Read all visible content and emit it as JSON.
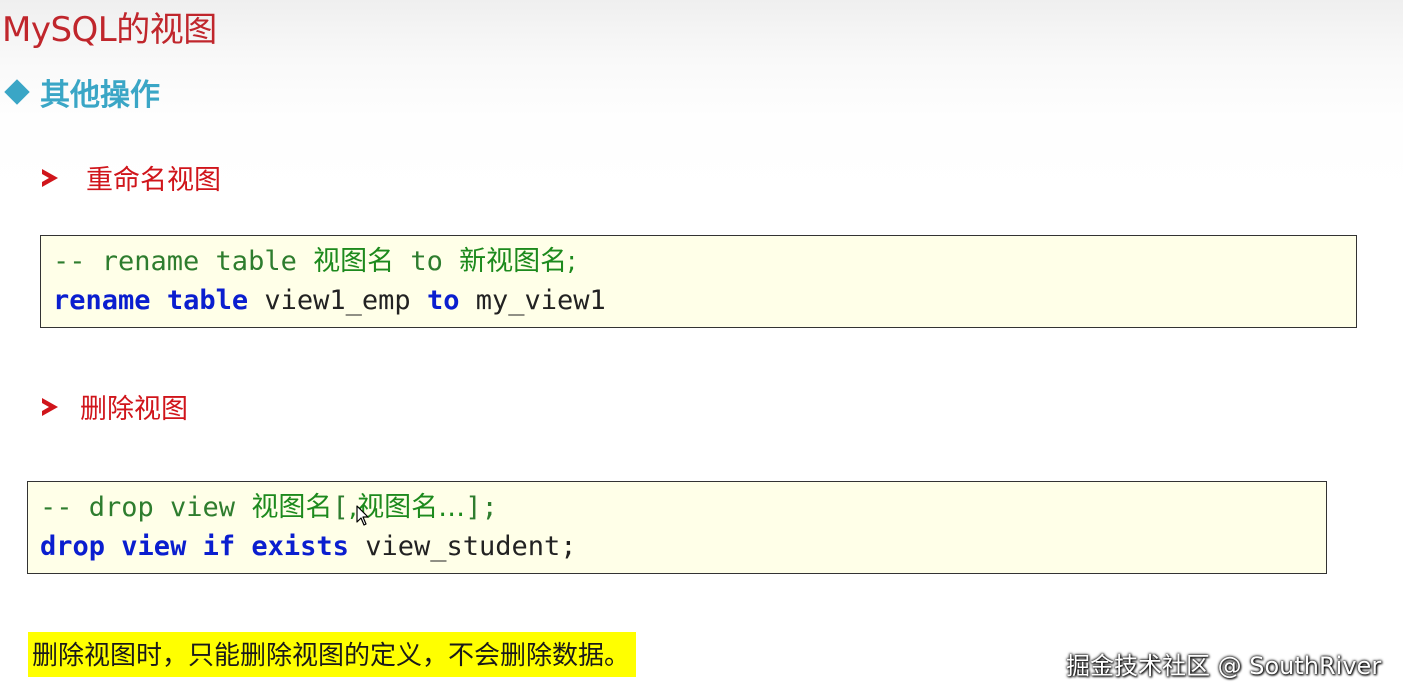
{
  "slide": {
    "title": "MySQL的视图",
    "section_heading": "其他操作"
  },
  "rename": {
    "heading": "重命名视图",
    "comment_prefix": "-- rename table ",
    "comment_name": "视图名",
    "comment_to": " to ",
    "comment_new_name": "新视图名;",
    "kw_rename": "rename",
    "kw_table": "table",
    "view_old": "view1_emp",
    "kw_to": "to",
    "view_new": "my_view1"
  },
  "drop": {
    "heading": "删除视图",
    "comment_prefix": "-- drop view ",
    "comment_name": "视图名",
    "comment_bracket_open": "[",
    "comment_more": ",视图名…",
    "comment_bracket_close": "];",
    "kw_drop": "drop",
    "kw_view": "view",
    "kw_if": "if",
    "kw_exists": "exists",
    "view_name": "view_student;"
  },
  "note": "删除视图时，只能删除视图的定义，不会删除数据。",
  "watermark": "掘金技术社区 @ SouthRiver",
  "colors": {
    "title": "#c0262c",
    "section": "#3aa6c6",
    "bullet": "#d0151b",
    "keyword": "#0a1ecf",
    "comment": "#2e7d2e",
    "highlight": "#ffff00",
    "code_bg": "#ffffe8"
  },
  "icons": {
    "section_marker": "diamond-icon",
    "bullet_marker": "arrow-right-icon",
    "cursor": "mouse-pointer-icon"
  }
}
